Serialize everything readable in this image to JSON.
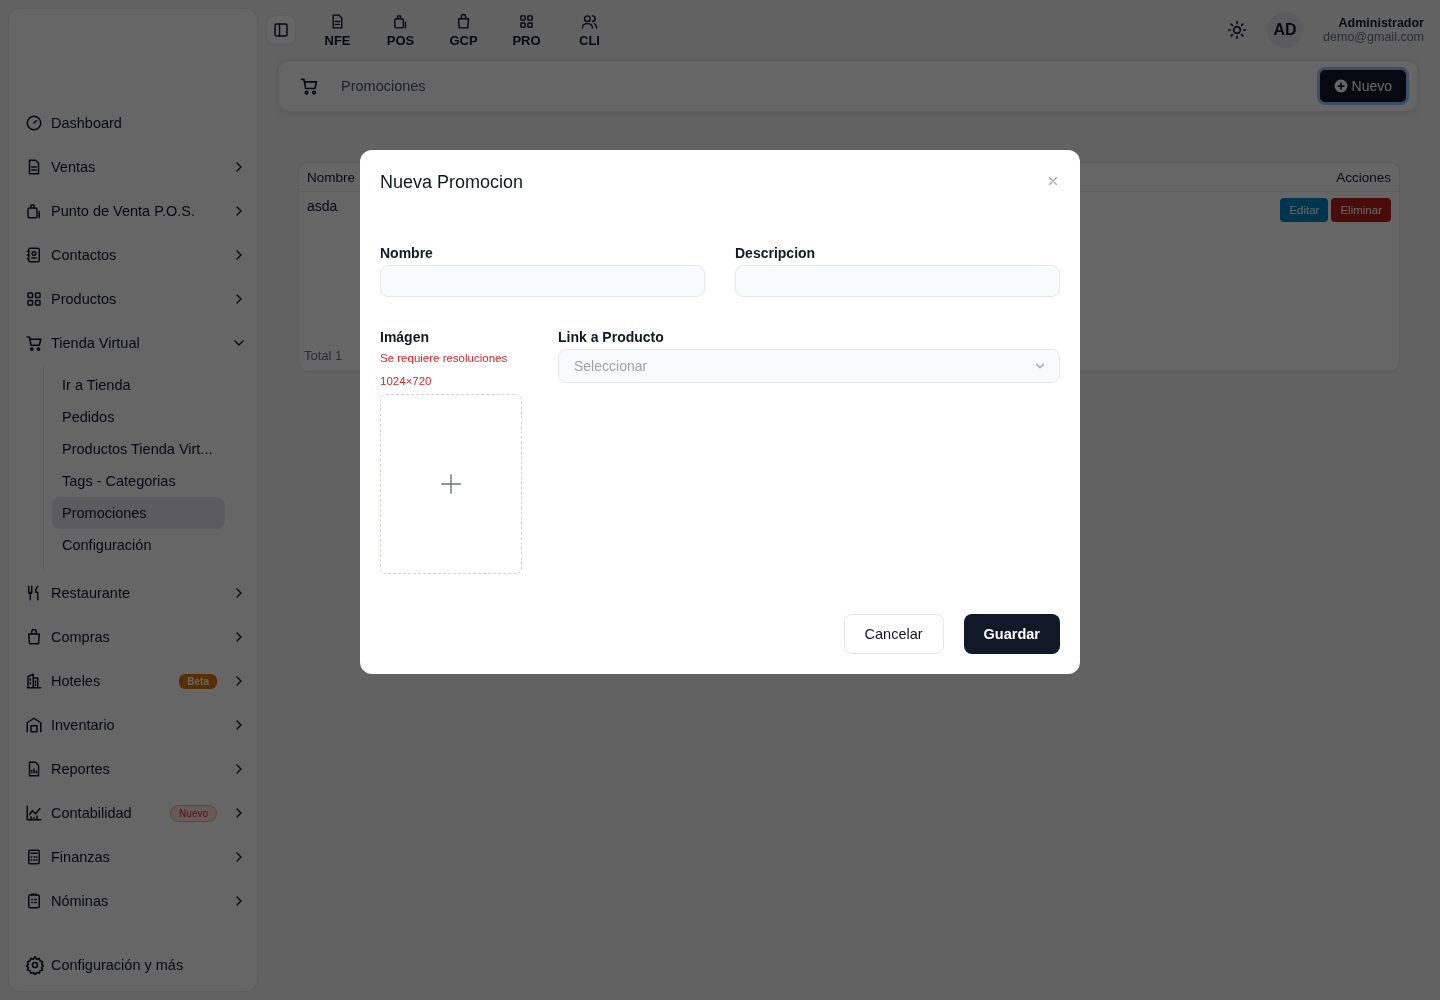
{
  "topbar": {
    "shortcuts": [
      {
        "label": "NFE"
      },
      {
        "label": "POS"
      },
      {
        "label": "GCP"
      },
      {
        "label": "PRO"
      },
      {
        "label": "CLI"
      }
    ],
    "user": {
      "initials": "AD",
      "name": "Administrador",
      "email": "demo@gmail.com"
    }
  },
  "sidebar": {
    "items": [
      {
        "label": "Dashboard",
        "kind": "link"
      },
      {
        "label": "Ventas",
        "kind": "group",
        "expanded": false
      },
      {
        "label": "Punto de Venta P.O.S.",
        "kind": "group",
        "expanded": false
      },
      {
        "label": "Contactos",
        "kind": "group",
        "expanded": false
      },
      {
        "label": "Productos",
        "kind": "group",
        "expanded": false
      },
      {
        "label": "Tienda Virtual",
        "kind": "group",
        "expanded": true,
        "children": [
          {
            "label": "Ir a Tienda",
            "selected": false
          },
          {
            "label": "Pedidos",
            "selected": false
          },
          {
            "label": "Productos Tienda Virt...",
            "selected": false
          },
          {
            "label": "Tags - Categorias",
            "selected": false
          },
          {
            "label": "Promociones",
            "selected": true
          },
          {
            "label": "Configuración",
            "selected": false
          }
        ]
      },
      {
        "label": "Restaurante",
        "kind": "group",
        "expanded": false
      },
      {
        "label": "Compras",
        "kind": "group",
        "expanded": false
      },
      {
        "label": "Hoteles",
        "kind": "group",
        "expanded": false,
        "badge": {
          "text": "Beta",
          "kind": "solid"
        }
      },
      {
        "label": "Inventario",
        "kind": "group",
        "expanded": false
      },
      {
        "label": "Reportes",
        "kind": "group",
        "expanded": false
      },
      {
        "label": "Contabilidad",
        "kind": "group",
        "expanded": false,
        "badge": {
          "text": "Nuevo",
          "kind": "soft"
        }
      },
      {
        "label": "Finanzas",
        "kind": "group",
        "expanded": false
      },
      {
        "label": "Nóminas",
        "kind": "group",
        "expanded": false
      }
    ],
    "footer": "Configuración y más"
  },
  "page": {
    "title": "Promociones",
    "new_button": "Nuevo"
  },
  "table": {
    "columns": [
      "Nombre",
      "Acciones"
    ],
    "rows": [
      {
        "cells": [
          "asda"
        ],
        "actions": [
          {
            "label": "Editar",
            "kind": "edit"
          },
          {
            "label": "Eliminar",
            "kind": "delete"
          }
        ]
      }
    ],
    "footer": "Total 1"
  },
  "modal": {
    "title": "Nueva Promocion",
    "fields": [
      {
        "label": "Nombre"
      },
      {
        "label": "Descripcion"
      }
    ],
    "image": {
      "label": "Imágen",
      "hint": "Se requiere resoluciones 1024×720"
    },
    "link": {
      "label": "Link a Producto",
      "placeholder": "Seleccionar"
    },
    "buttons": [
      {
        "label": "Cancelar",
        "kind": "secondary"
      },
      {
        "label": "Guardar",
        "kind": "primary"
      }
    ]
  }
}
